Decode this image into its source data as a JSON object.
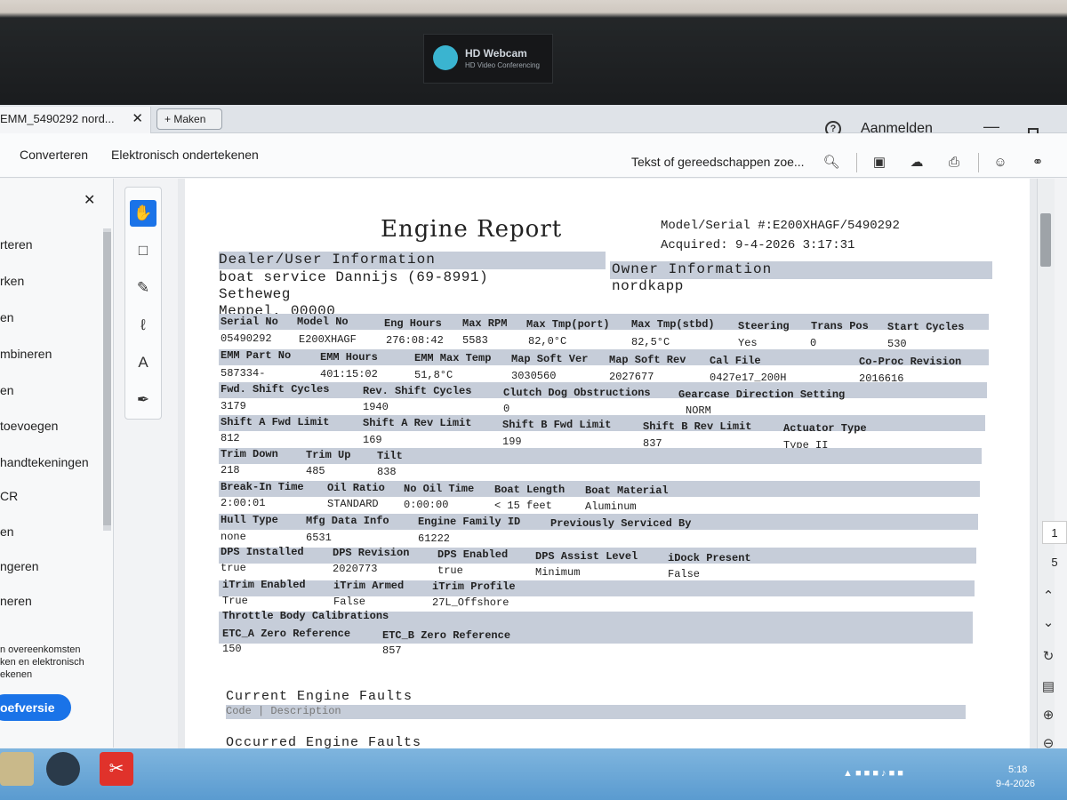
{
  "webcam": {
    "title": "HD Webcam",
    "subtitle": "HD Video Conferencing"
  },
  "browser": {
    "tab_title": "EMM_5490292 nord...",
    "new_tab_label": "Maken",
    "help_icon": "question-circle-icon",
    "signin_label": "Aanmelden"
  },
  "menubar": {
    "items": [
      "Converteren",
      "Elektronisch ondertekenen"
    ],
    "search_placeholder": "Tekst of gereedschappen zoe..."
  },
  "left_panel": {
    "items": [
      "rteren",
      "rken",
      "en",
      "mbineren",
      "en",
      "toevoegen",
      "handtekeningen",
      "CR",
      "en",
      "ngeren",
      "neren"
    ],
    "promo_lines": [
      "n overeenkomsten",
      "ken en elektronisch",
      "ekenen"
    ],
    "promo_button": "oefversie"
  },
  "page_nav": {
    "current": "1",
    "total": "5"
  },
  "report": {
    "title": "Engine Report",
    "model_serial": "Model/Serial #:E200XHAGF/5490292",
    "acquired": "Acquired: 9-4-2026 3:17:31",
    "dealer": {
      "heading": "Dealer/User Information",
      "lines": [
        "boat service Dannijs (69-8991)",
        "Setheweg",
        "Meppel, 00000"
      ]
    },
    "owner": {
      "heading": "Owner Information",
      "name": "nordkapp"
    },
    "r1": {
      "labels": [
        "Serial No",
        "Model No",
        "Eng Hours",
        "Max RPM",
        "Max Tmp(port)",
        "Max Tmp(stbd)",
        "Steering",
        "Trans Pos",
        "Start Cycles"
      ],
      "values": [
        "05490292",
        "E200XHAGF",
        "276:08:42",
        "5583",
        "82,0°C",
        "82,5°C",
        "Yes",
        "0",
        "530"
      ]
    },
    "r2": {
      "labels": [
        "EMM Part No",
        "EMM Hours",
        "EMM Max Temp",
        "Map Soft Ver",
        "Map Soft Rev",
        "Cal File",
        "Co-Proc Revision"
      ],
      "values": [
        "587334-",
        "401:15:02",
        "51,8°C",
        "3030560",
        "2027677",
        "0427e17_200H",
        "2016616"
      ]
    },
    "r3": {
      "labels": [
        "Fwd. Shift Cycles",
        "Rev. Shift Cycles",
        "Clutch Dog Obstructions",
        "Gearcase Direction Setting"
      ],
      "values": [
        "3179",
        "1940",
        "0",
        "NORM"
      ]
    },
    "r4": {
      "labels": [
        "Shift A Fwd Limit",
        "Shift A Rev Limit",
        "Shift B Fwd Limit",
        "Shift B Rev Limit",
        "Actuator Type"
      ],
      "values": [
        "812",
        "169",
        "199",
        "837",
        "Type II"
      ]
    },
    "r5": {
      "labels": [
        "Trim Down",
        "Trim Up",
        "Tilt"
      ],
      "values": [
        "218",
        "485",
        "838"
      ]
    },
    "r6": {
      "labels": [
        "Break-In Time",
        "Oil Ratio",
        "No Oil Time",
        "Boat Length",
        "Boat Material"
      ],
      "values": [
        "2:00:01",
        "STANDARD",
        "0:00:00",
        "< 15 feet",
        "Aluminum"
      ]
    },
    "r7": {
      "labels": [
        "Hull Type",
        "Mfg Data Info",
        "Engine Family ID",
        "Previously Serviced By"
      ],
      "values": [
        "none",
        "6531",
        "61222"
      ]
    },
    "r8": {
      "labels": [
        "DPS Installed",
        "DPS Revision",
        "DPS Enabled",
        "DPS Assist Level",
        "iDock Present"
      ],
      "values": [
        "true",
        "2020773",
        "true",
        "Minimum",
        "False"
      ]
    },
    "r9": {
      "labels": [
        "iTrim Enabled",
        "iTrim Armed",
        "iTrim Profile"
      ],
      "values": [
        "True",
        "False",
        "27L_Offshore"
      ]
    },
    "r10": {
      "labels": [
        "Throttle Body Calibrations"
      ]
    },
    "r11": {
      "labels": [
        "ETC_A Zero Reference",
        "ETC_B Zero Reference"
      ],
      "values": [
        "150",
        "857"
      ]
    },
    "current_faults": {
      "heading": "Current Engine Faults",
      "sub": "Code | Description"
    },
    "occurred_faults": {
      "heading": "Occurred Engine Faults"
    }
  },
  "taskbar": {
    "time": "5:18",
    "date": "9-4-2026"
  }
}
